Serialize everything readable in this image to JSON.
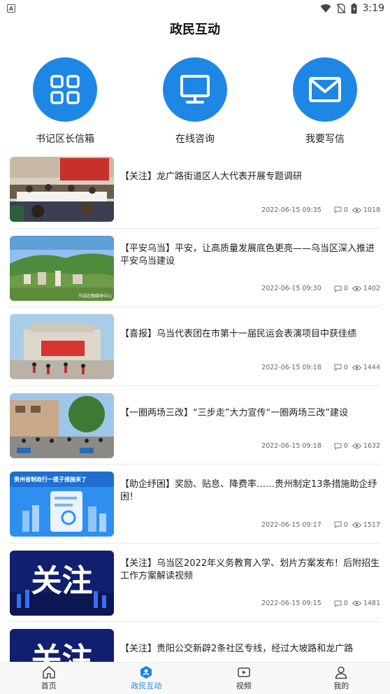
{
  "status_bar": {
    "left_label": "A",
    "time": "3:19"
  },
  "header": {
    "title": "政民互动"
  },
  "quick_actions": [
    {
      "label": "书记区长信箱",
      "icon": "grid-icon"
    },
    {
      "label": "在线咨询",
      "icon": "monitor-icon"
    },
    {
      "label": "我要写信",
      "icon": "mail-icon"
    }
  ],
  "news": [
    {
      "title": "【关注】龙广路街道区人大代表开展专题调研",
      "date": "2022-06-15 09:35",
      "comments": "0",
      "views": "1018"
    },
    {
      "title": "【平安乌当】平安，让高质量发展底色更亮——乌当区深入推进平安乌当建设",
      "date": "2022-06-15 09:30",
      "comments": "0",
      "views": "1402"
    },
    {
      "title": "【喜报】乌当代表团在市第十一届民运会表演项目中获佳绩",
      "date": "2022-06-15 09:18",
      "comments": "0",
      "views": "1444"
    },
    {
      "title": "【一圈两场三改】“三步走”大力宣传“一圈两场三改”建设",
      "date": "2022-06-15 09:18",
      "comments": "0",
      "views": "1632"
    },
    {
      "title": "【助企纾困】奖励、贴息、降费率……贵州制定13条措施助企纾困！",
      "date": "2022-06-15 09:17",
      "comments": "0",
      "views": "1517"
    },
    {
      "title": "【关注】乌当区2022年义务教育入学、划片方案发布！后附招生工作方案解读视频",
      "date": "2022-06-15 09:15",
      "comments": "0",
      "views": "1481"
    },
    {
      "title": "【关注】贵阳公交新辟2条社区专线，经过大坡路和龙广路",
      "date": "",
      "comments": "",
      "views": ""
    }
  ],
  "thumb_text": {
    "guanzhu": "关注",
    "guizhou_banner": "贵州省制政行一揽子措施来了",
    "watermark": "乌当区融媒体中心"
  },
  "bottom_nav": [
    {
      "label": "首页",
      "icon": "home-icon"
    },
    {
      "label": "政民互动",
      "icon": "interaction-icon",
      "active": true
    },
    {
      "label": "视频",
      "icon": "video-icon"
    },
    {
      "label": "我的",
      "icon": "user-icon"
    }
  ],
  "colors": {
    "accent": "#1e87e5",
    "text": "#222222",
    "meta": "#666666"
  }
}
